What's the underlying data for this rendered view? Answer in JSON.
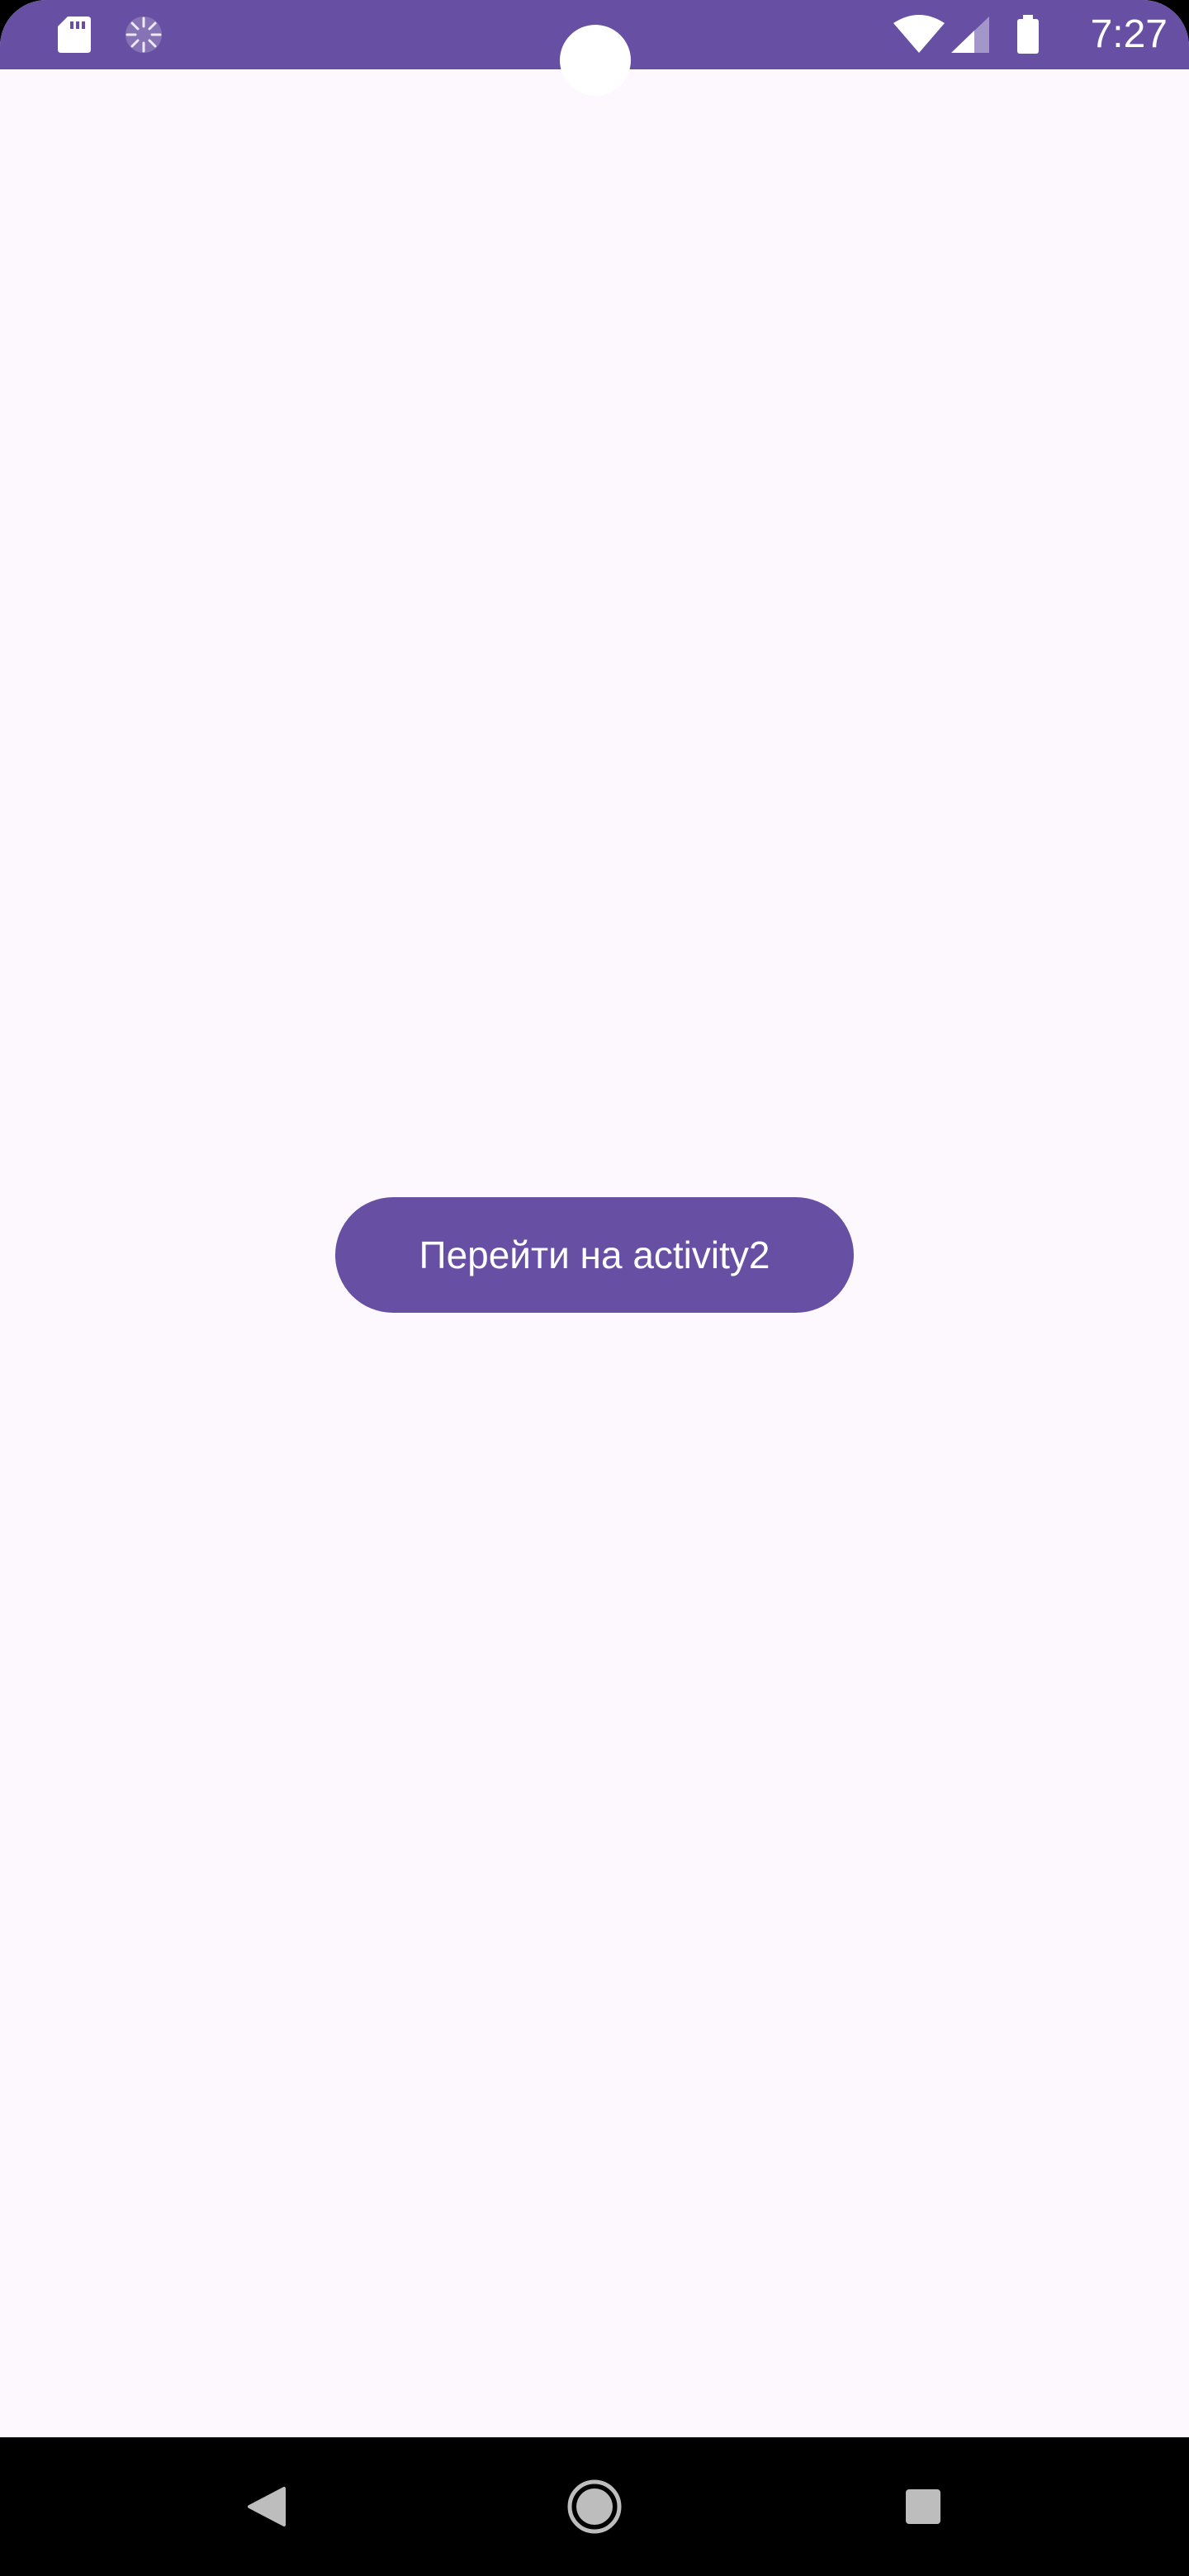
{
  "status_bar": {
    "time": "7:27",
    "background": "#6750a4",
    "icons": [
      "sd-card-icon",
      "sync-icon",
      "wifi-icon",
      "cellular-signal-icon",
      "battery-icon"
    ]
  },
  "main": {
    "background": "#fdf7fe",
    "button_label": "Перейти на activity2",
    "button_color": "#6750a4",
    "button_text_color": "#ffffff"
  },
  "nav_bar": {
    "background": "#000000",
    "buttons": [
      "back-icon",
      "home-icon",
      "recents-icon"
    ]
  }
}
